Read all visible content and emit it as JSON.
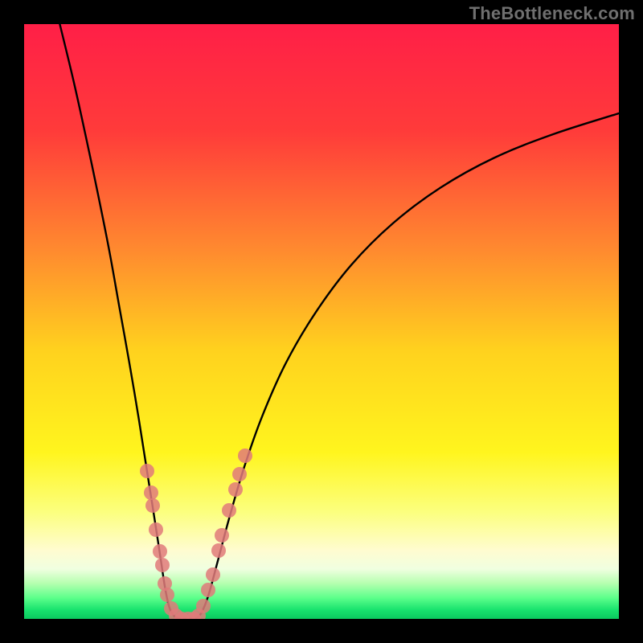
{
  "watermark": "TheBottleneck.com",
  "chart_data": {
    "type": "line",
    "title": "",
    "xlabel": "",
    "ylabel": "",
    "xlim": [
      0,
      1
    ],
    "ylim": [
      0,
      1
    ],
    "gradient_stops": [
      {
        "offset": 0.0,
        "color": "#ff1f47"
      },
      {
        "offset": 0.18,
        "color": "#ff3b3a"
      },
      {
        "offset": 0.38,
        "color": "#ff8a2f"
      },
      {
        "offset": 0.55,
        "color": "#ffd21e"
      },
      {
        "offset": 0.72,
        "color": "#fff51e"
      },
      {
        "offset": 0.82,
        "color": "#fcff7e"
      },
      {
        "offset": 0.885,
        "color": "#fffcd0"
      },
      {
        "offset": 0.916,
        "color": "#f0ffe0"
      },
      {
        "offset": 0.94,
        "color": "#b6ffb0"
      },
      {
        "offset": 0.965,
        "color": "#5bff8a"
      },
      {
        "offset": 0.985,
        "color": "#18e26e"
      },
      {
        "offset": 1.0,
        "color": "#0bc95f"
      }
    ],
    "series": [
      {
        "name": "left-branch",
        "color": "#000000",
        "width": 2.4,
        "points": [
          {
            "x": 0.06,
            "y": 1.0
          },
          {
            "x": 0.083,
            "y": 0.905
          },
          {
            "x": 0.104,
            "y": 0.81
          },
          {
            "x": 0.124,
            "y": 0.715
          },
          {
            "x": 0.143,
            "y": 0.62
          },
          {
            "x": 0.16,
            "y": 0.525
          },
          {
            "x": 0.177,
            "y": 0.43
          },
          {
            "x": 0.193,
            "y": 0.335
          },
          {
            "x": 0.208,
            "y": 0.24
          },
          {
            "x": 0.219,
            "y": 0.17
          },
          {
            "x": 0.229,
            "y": 0.105
          },
          {
            "x": 0.237,
            "y": 0.052
          },
          {
            "x": 0.244,
            "y": 0.02
          },
          {
            "x": 0.252,
            "y": 0.005
          },
          {
            "x": 0.262,
            "y": 0.0
          }
        ]
      },
      {
        "name": "valley-floor",
        "color": "#000000",
        "width": 2.4,
        "points": [
          {
            "x": 0.262,
            "y": 0.0
          },
          {
            "x": 0.27,
            "y": 0.0
          },
          {
            "x": 0.28,
            "y": 0.0
          },
          {
            "x": 0.288,
            "y": 0.0
          }
        ]
      },
      {
        "name": "right-branch",
        "color": "#000000",
        "width": 2.4,
        "points": [
          {
            "x": 0.288,
            "y": 0.0
          },
          {
            "x": 0.298,
            "y": 0.01
          },
          {
            "x": 0.31,
            "y": 0.04
          },
          {
            "x": 0.325,
            "y": 0.095
          },
          {
            "x": 0.345,
            "y": 0.17
          },
          {
            "x": 0.37,
            "y": 0.255
          },
          {
            "x": 0.4,
            "y": 0.34
          },
          {
            "x": 0.44,
            "y": 0.43
          },
          {
            "x": 0.49,
            "y": 0.515
          },
          {
            "x": 0.55,
            "y": 0.595
          },
          {
            "x": 0.62,
            "y": 0.665
          },
          {
            "x": 0.7,
            "y": 0.725
          },
          {
            "x": 0.79,
            "y": 0.775
          },
          {
            "x": 0.89,
            "y": 0.815
          },
          {
            "x": 1.0,
            "y": 0.85
          }
        ]
      }
    ],
    "markers": {
      "color": "#e17a7a",
      "opacity": 0.85,
      "radius": 9,
      "points": [
        {
          "x": 0.207,
          "y": 0.248
        },
        {
          "x": 0.213,
          "y": 0.212
        },
        {
          "x": 0.216,
          "y": 0.19
        },
        {
          "x": 0.222,
          "y": 0.15
        },
        {
          "x": 0.228,
          "y": 0.113
        },
        {
          "x": 0.232,
          "y": 0.09
        },
        {
          "x": 0.237,
          "y": 0.06
        },
        {
          "x": 0.241,
          "y": 0.04
        },
        {
          "x": 0.247,
          "y": 0.018
        },
        {
          "x": 0.255,
          "y": 0.005
        },
        {
          "x": 0.265,
          "y": 0.0
        },
        {
          "x": 0.275,
          "y": 0.0
        },
        {
          "x": 0.285,
          "y": 0.0
        },
        {
          "x": 0.293,
          "y": 0.006
        },
        {
          "x": 0.301,
          "y": 0.022
        },
        {
          "x": 0.31,
          "y": 0.048
        },
        {
          "x": 0.317,
          "y": 0.075
        },
        {
          "x": 0.327,
          "y": 0.115
        },
        {
          "x": 0.333,
          "y": 0.14
        },
        {
          "x": 0.345,
          "y": 0.182
        },
        {
          "x": 0.355,
          "y": 0.218
        },
        {
          "x": 0.362,
          "y": 0.243
        },
        {
          "x": 0.372,
          "y": 0.275
        }
      ]
    }
  }
}
